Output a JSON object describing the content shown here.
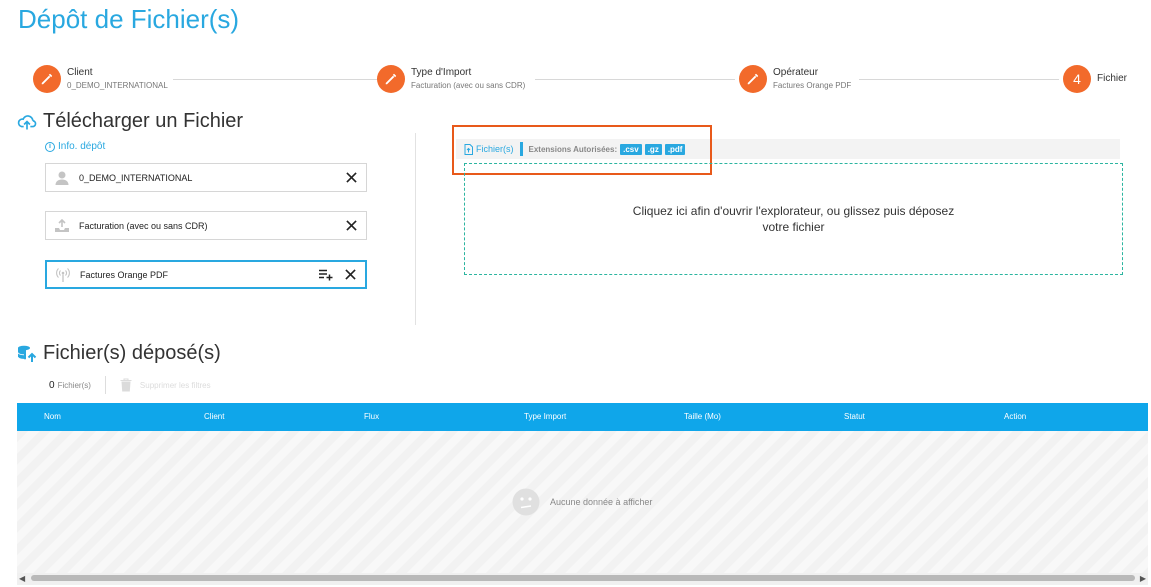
{
  "page": {
    "title": "Dépôt de Fichier(s)"
  },
  "steps": [
    {
      "name": "Client",
      "sub": "0_DEMO_INTERNATIONAL",
      "icon": "pencil-icon"
    },
    {
      "name": "Type d'Import",
      "sub": "Facturation (avec ou sans CDR)",
      "icon": "pencil-icon"
    },
    {
      "name": "Opérateur",
      "sub": "Factures Orange PDF",
      "icon": "pencil-icon"
    },
    {
      "name": "Fichier",
      "number": "4"
    }
  ],
  "upload_section": {
    "title": "Télécharger un Fichier",
    "info_link": "Info. dépôt",
    "fields": [
      {
        "value": "0_DEMO_INTERNATIONAL",
        "icon": "user-icon"
      },
      {
        "value": "Facturation (avec ou sans CDR)",
        "icon": "upload-tray-icon"
      },
      {
        "value": "Factures Orange PDF",
        "icon": "antenna-icon"
      }
    ],
    "tab_label": "Fichier(s)",
    "extensions_label": "Extensions Autorisées:",
    "extensions": [
      ".csv",
      ".gz",
      ".pdf"
    ],
    "dropzone_text": "Cliquez ici afin d'ouvrir l'explorateur, ou glissez puis déposez votre fichier"
  },
  "files_section": {
    "title": "Fichier(s) déposé(s)",
    "count": "0",
    "count_label": "Fichier(s)",
    "delete_label": "Supprimer les filtres",
    "columns": [
      "Nom",
      "Client",
      "Flux",
      "Type Import",
      "Taille (Mo)",
      "Statut",
      "Action"
    ],
    "empty_message": "Aucune donnée à afficher"
  },
  "colors": {
    "accent": "#29a8e0",
    "step": "#f26a2b",
    "highlight": "#e8591a",
    "table_head": "#0fa6ea",
    "dropzone_border": "#2cb5a0"
  }
}
